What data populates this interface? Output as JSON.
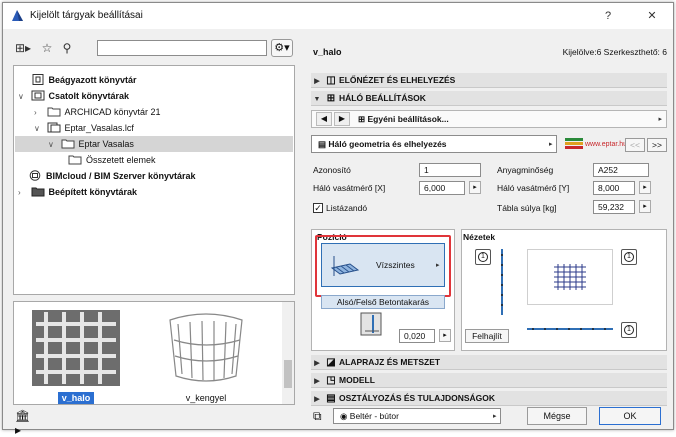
{
  "window": {
    "title": "Kijelölt tárgyak beállításai",
    "help": "?",
    "close": "✕"
  },
  "library": {
    "search_placeholder": "",
    "tree": [
      {
        "label": "Beágyazott könyvtár",
        "bold": true
      },
      {
        "label": "Csatolt könyvtárak",
        "bold": true
      },
      {
        "label": "ARCHICAD könyvtár 21",
        "bold": false
      },
      {
        "label": "Eptar_Vasalas.lcf",
        "bold": false
      },
      {
        "label": "Eptar Vasalas",
        "bold": false
      },
      {
        "label": "Összetett elemek",
        "bold": false
      },
      {
        "label": "BIMcloud / BIM Szerver könyvtárak",
        "bold": true
      },
      {
        "label": "Beépített könyvtárak",
        "bold": true
      }
    ],
    "thumbnails": [
      {
        "label": "v_halo",
        "selected": true
      },
      {
        "label": "v_kengyel",
        "selected": false
      }
    ]
  },
  "settings": {
    "object_name": "v_halo",
    "selection_info": "Kijelölve:6 Szerkeszthető: 6",
    "sections_top": [
      {
        "label": "ELŐNÉZET ÉS ELHELYEZÉS",
        "expanded": false
      },
      {
        "label": "HÁLÓ BEÁLLÍTÁSOK",
        "expanded": true
      }
    ],
    "custom_settings": "Egyéni beállítások...",
    "page_dropdown": "Háló geometria és elhelyezés",
    "brand": "www.eptar.hu",
    "nav_prev": "<<",
    "nav_next": ">>",
    "params": {
      "azonosito_label": "Azonosító",
      "azonosito_value": "1",
      "anyag_label": "Anyagminőség",
      "anyag_value": "A252",
      "halo_x_label": "Háló vasátmérő [X]",
      "halo_x_value": "6,000",
      "halo_y_label": "Háló vasátmérő [Y]",
      "halo_y_value": "8,000",
      "listazando_label": "Listázandó",
      "tabla_label": "Tábla súlya [kg]",
      "tabla_value": "59,232"
    },
    "pozicio": {
      "title": "Pozíció",
      "button_label": "Vízszintes",
      "layer_label": "Alsó/Felső Betontakarás",
      "cover_value": "0,020"
    },
    "nezetek": {
      "title": "Nézetek",
      "felhajlit_label": "Felhajlít",
      "view_marker": "1"
    },
    "sections_bottom": [
      {
        "label": "ALAPRAJZ ÉS METSZET"
      },
      {
        "label": "MODELL"
      },
      {
        "label": "OSZTÁLYOZÁS ÉS TULAJDONSÁGOK"
      }
    ],
    "layer_dropdown": "Beltér - bútor",
    "cancel_label": "Mégse",
    "ok_label": "OK"
  },
  "colors": {
    "accent": "#2b6fd1",
    "highlight": "#e0353a",
    "section_bg": "#e2e2e2"
  }
}
